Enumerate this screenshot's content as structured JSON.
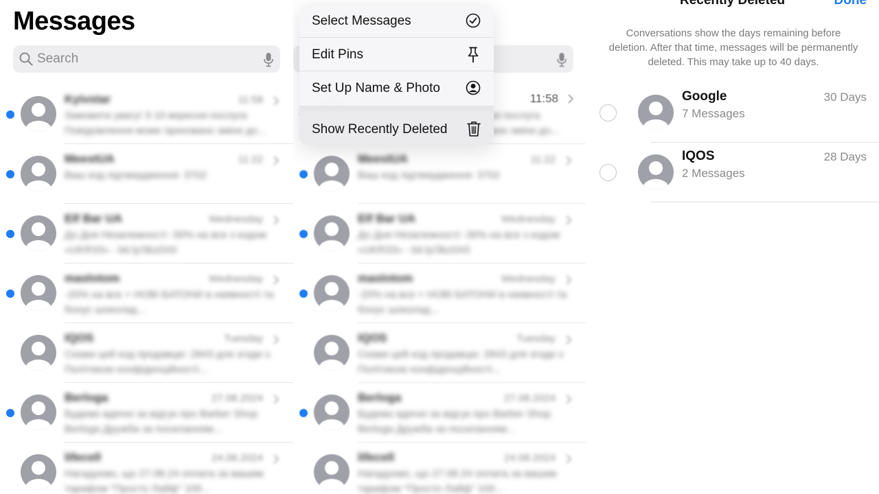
{
  "messages": {
    "title": "Messages",
    "search_placeholder": "Search",
    "conversations": [
      {
        "name": "Kyivstar",
        "time": "11:58",
        "preview": "Замовити увагу! З 10 вересня послуга Повідомлення може приховано зміни до...",
        "unread": true
      },
      {
        "name": "MeestUA",
        "time": "11:22",
        "preview": "Ваш код підтвердження: 3702",
        "unread": true
      },
      {
        "name": "Elf Bar UA",
        "time": "Wednesday",
        "preview": "До Дня Незалежності -30% на все з кодом «UKR33» - bit.ly/3kz0X0",
        "unread": true
      },
      {
        "name": "maslotom",
        "time": "Wednesday",
        "preview": "-20% на все + НОВІ БАТОНИ в наявності та бонус шоколад...",
        "unread": true
      },
      {
        "name": "IQOS",
        "time": "Tuesday",
        "preview": "Скажи цей код продавцю: 2843 для згоди з Політикою конфіденційності...",
        "unread": false
      },
      {
        "name": "Berloga",
        "time": "27.08.2024",
        "preview": "Будемо вдячні за відгук про Barber Shop Berloga Дружба за посиланням...",
        "unread": true
      },
      {
        "name": "lifecell",
        "time": "24.08.2024",
        "preview": "Нагадуємо, що 27.08.24 оплата за вашим тарифом \"Просто Лайф\" 100...",
        "unread": false
      }
    ]
  },
  "menu": {
    "items": [
      {
        "label": "Select Messages",
        "icon": "checkmark-circle-icon"
      },
      {
        "label": "Edit Pins",
        "icon": "pin-icon"
      },
      {
        "label": "Set Up Name & Photo",
        "icon": "person-circle-icon"
      },
      {
        "label": "Show Recently Deleted",
        "icon": "trash-icon"
      }
    ],
    "first_time": "11:58"
  },
  "recently_deleted": {
    "title": "Recently Deleted",
    "done_label": "Done",
    "info": "Conversations show the days remaining before deletion. After that time, messages will be permanently deleted. This may take up to 40 days.",
    "items": [
      {
        "name": "Google",
        "count": "7 Messages",
        "days": "30 Days"
      },
      {
        "name": "IQOS",
        "count": "2 Messages",
        "days": "28 Days"
      }
    ]
  },
  "colors": {
    "accent": "#1e7cf5",
    "unread_dot": "#1e7cf5",
    "avatar": "#a0a0a8",
    "secondary_text": "#8a8a8e"
  }
}
